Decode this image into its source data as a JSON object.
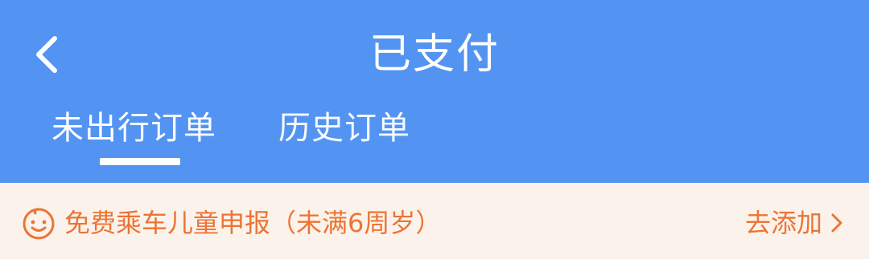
{
  "header": {
    "title": "已支付",
    "back_icon": "chevron-left-icon",
    "background_color": "#5394f3"
  },
  "tabs": [
    {
      "label": "未出行订单",
      "active": true
    },
    {
      "label": "历史订单",
      "active": false
    }
  ],
  "notice": {
    "icon": "child-face-icon",
    "text": "免费乘车儿童申报（未满6周岁）",
    "action_label": "去添加",
    "action_icon": "chevron-right-icon",
    "text_color": "#ec7434",
    "background_color": "#fbf3eb"
  }
}
